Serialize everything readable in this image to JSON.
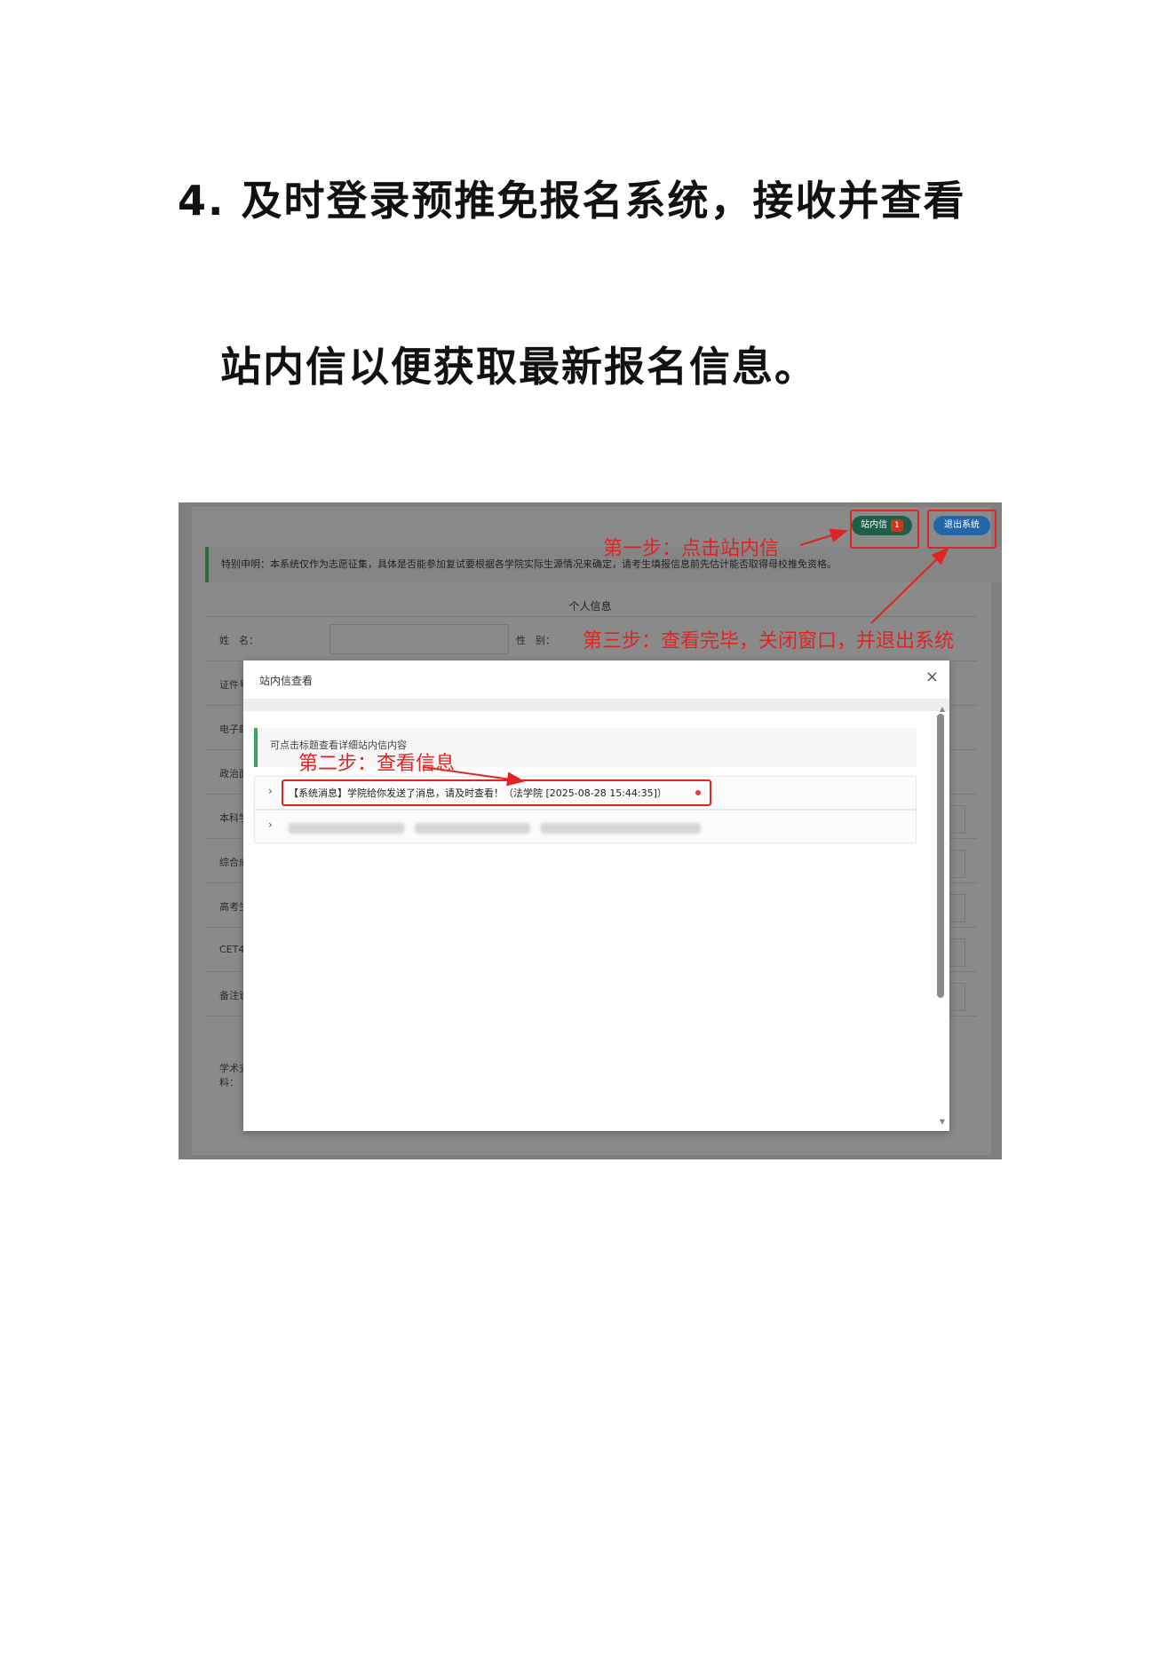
{
  "document": {
    "heading_line1": "4. 及时登录预推免报名系统，接收并查看",
    "heading_line2": "站内信以便获取最新报名信息。"
  },
  "app": {
    "notice": "特别申明：本系统仅作为志愿征集，具体是否能参加复试要根据各学院实际生源情况来确定，请考生填报信息前先估计能否取得母校推免资格。",
    "section_title": "个人信息",
    "buttons": {
      "messages_label": "站内信",
      "messages_badge": "1",
      "exit_label": "退出系统"
    },
    "form": {
      "name_label": "姓　名：",
      "gender_label": "性　别：",
      "row_labels": [
        "证件号",
        "电子邮",
        "政治面",
        "本科学",
        "综合成",
        "高考生",
        "CET4",
        "备注说",
        "学术支\n料："
      ]
    }
  },
  "modal": {
    "title": "站内信查看",
    "close_icon": "×",
    "hint": "可点击标题查看详细站内信内容",
    "messages": [
      {
        "text": "【系统消息】学院给你发送了消息，请及时查看！（法学院 [2025-08-28 15:44:35]）",
        "unread": true
      },
      {
        "text": "",
        "unread": false
      }
    ]
  },
  "annotations": {
    "step1": "第一步：点击站内信",
    "step2": "第二步：查看信息",
    "step3": "第三步：查看完毕，关闭窗口，并退出系统",
    "color": "#e02424"
  }
}
